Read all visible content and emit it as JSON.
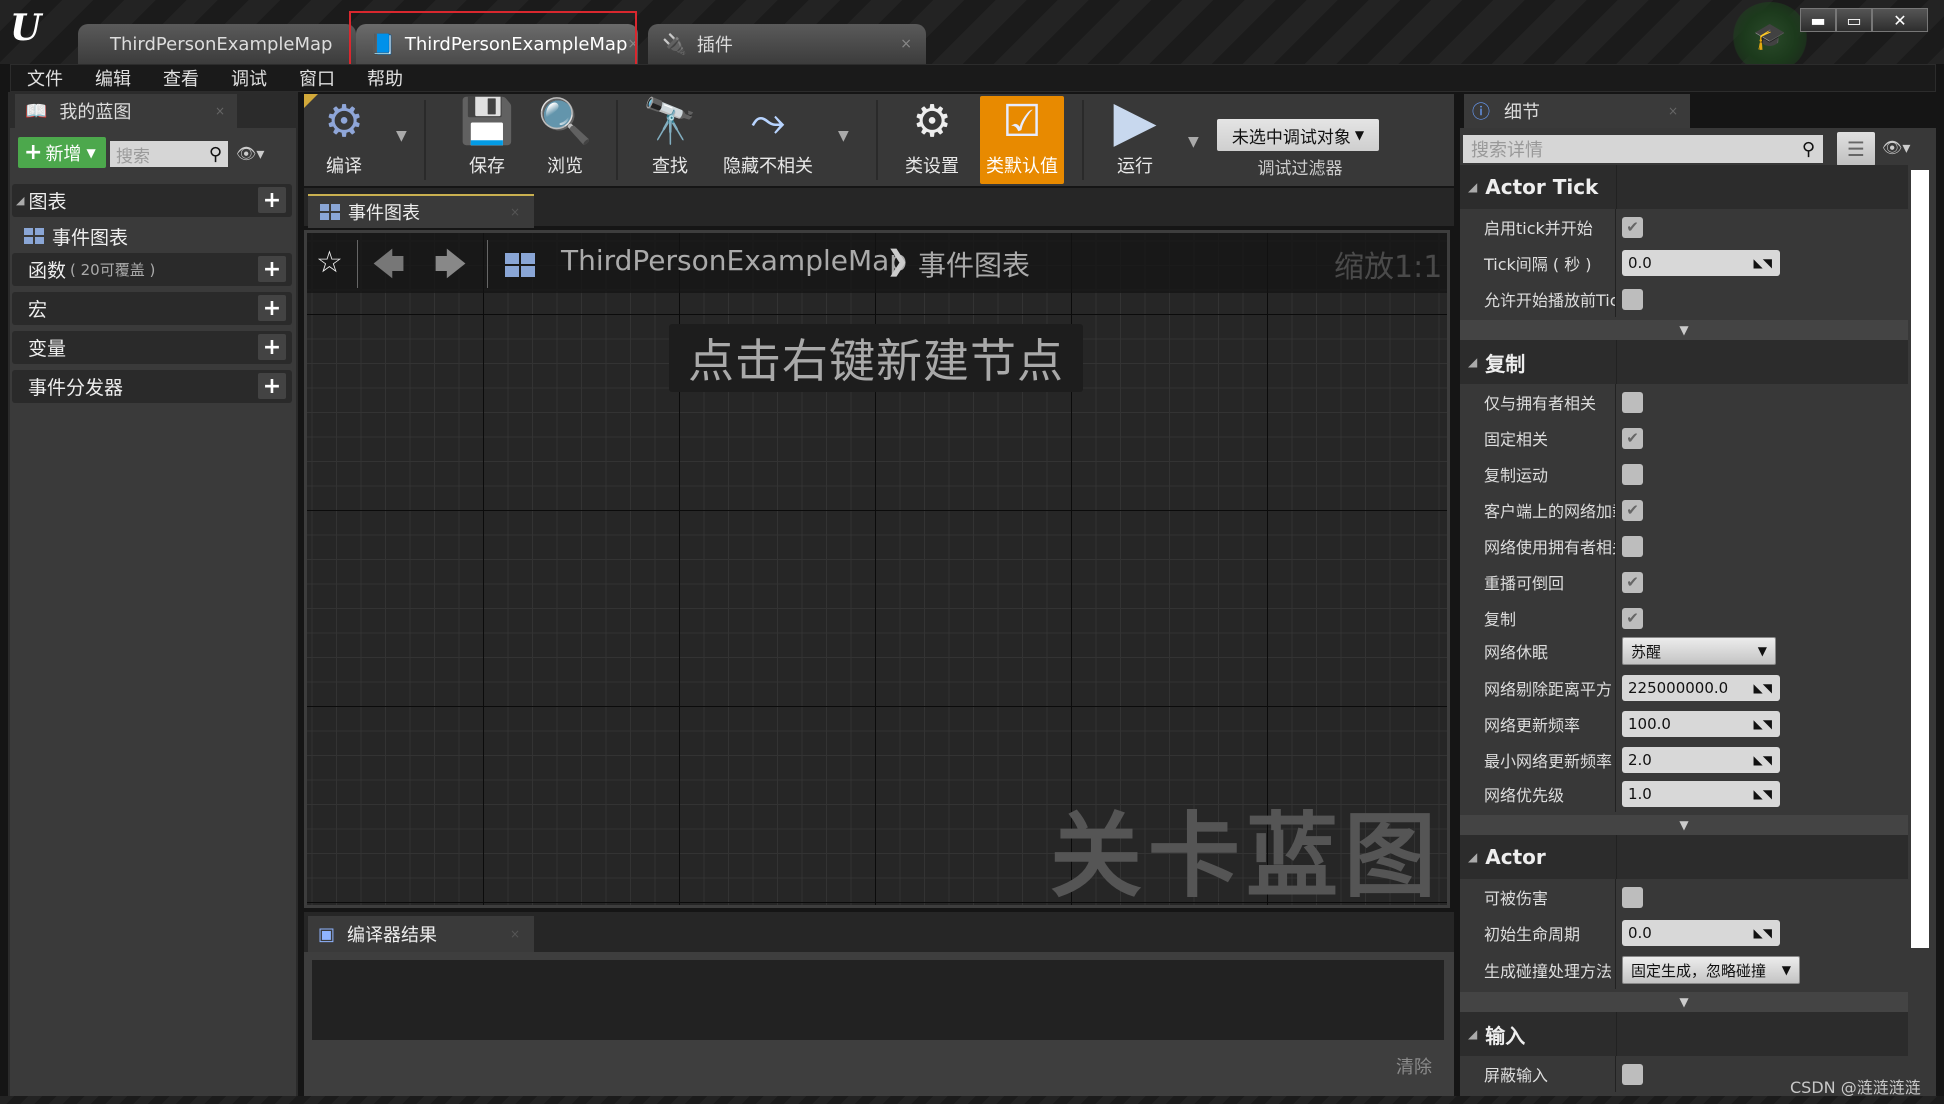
{
  "window": {
    "tabs": [
      {
        "label": "ThirdPersonExampleMap",
        "active": false
      },
      {
        "label": "ThirdPersonExampleMap",
        "active": true
      },
      {
        "label": "插件",
        "active": false
      }
    ],
    "controls": {
      "minimize": "▬",
      "maximize": "▭",
      "close": "✕"
    }
  },
  "menu": [
    "文件",
    "编辑",
    "查看",
    "调试",
    "窗口",
    "帮助"
  ],
  "my_blueprint": {
    "tab_label": "我的蓝图",
    "new_button": "新增",
    "search_placeholder": "搜索",
    "categories": [
      {
        "label": "图表"
      },
      {
        "label": "函数",
        "sub": "( 20可覆盖 )"
      },
      {
        "label": "宏"
      },
      {
        "label": "变量"
      },
      {
        "label": "事件分发器"
      }
    ],
    "graph_item": "事件图表"
  },
  "toolbar": {
    "buttons": [
      {
        "label": "编译",
        "icon": "compile-icon"
      },
      {
        "label": "保存",
        "icon": "save-icon"
      },
      {
        "label": "浏览",
        "icon": "browse-icon"
      },
      {
        "label": "查找",
        "icon": "find-icon"
      },
      {
        "label": "隐藏不相关",
        "icon": "hide-unrelated-icon"
      },
      {
        "label": "类设置",
        "icon": "class-settings-icon"
      },
      {
        "label": "类默认值",
        "icon": "class-defaults-icon",
        "active": true
      },
      {
        "label": "运行",
        "icon": "play-icon"
      }
    ],
    "debug_select": "未选中调试对象",
    "debug_label": "调试过滤器"
  },
  "graph": {
    "tab_label": "事件图表",
    "breadcrumb": [
      "ThirdPersonExampleMap",
      "事件图表"
    ],
    "breadcrumb_sep": "❯",
    "zoom": "缩放1:1",
    "hint": "点击右键新建节点",
    "watermark": "关卡蓝图"
  },
  "compiler": {
    "tab_label": "编译器结果",
    "clear": "清除"
  },
  "details": {
    "tab_label": "细节",
    "search_placeholder": "搜索详情",
    "sections": {
      "actor_tick": {
        "title": "Actor Tick",
        "rows": [
          {
            "label": "启用tick并开始",
            "type": "checkbox",
            "checked": true
          },
          {
            "label": "Tick间隔 ( 秒 )",
            "type": "number",
            "value": "0.0"
          },
          {
            "label": "允许开始播放前Tick",
            "type": "checkbox",
            "checked": false
          }
        ]
      },
      "replication": {
        "title": "复制",
        "rows": [
          {
            "label": "仅与拥有者相关",
            "type": "checkbox",
            "checked": false
          },
          {
            "label": "固定相关",
            "type": "checkbox",
            "checked": true
          },
          {
            "label": "复制运动",
            "type": "checkbox",
            "checked": false
          },
          {
            "label": "客户端上的网络加载",
            "type": "checkbox",
            "checked": true
          },
          {
            "label": "网络使用拥有者相关性",
            "type": "checkbox",
            "checked": false
          },
          {
            "label": "重播可倒回",
            "type": "checkbox",
            "checked": true
          },
          {
            "label": "复制",
            "type": "checkbox",
            "checked": true
          },
          {
            "label": "网络休眠",
            "type": "dropdown",
            "value": "苏醒"
          },
          {
            "label": "网络剔除距离平方",
            "type": "number",
            "value": "225000000.0"
          },
          {
            "label": "网络更新频率",
            "type": "number",
            "value": "100.0"
          },
          {
            "label": "最小网络更新频率",
            "type": "number",
            "value": "2.0"
          },
          {
            "label": "网络优先级",
            "type": "number",
            "value": "1.0"
          }
        ]
      },
      "actor": {
        "title": "Actor",
        "rows": [
          {
            "label": "可被伤害",
            "type": "checkbox",
            "checked": false
          },
          {
            "label": "初始生命周期",
            "type": "number",
            "value": "0.0"
          },
          {
            "label": "生成碰撞处理方法",
            "type": "dropdown",
            "value": "固定生成，忽略碰撞"
          }
        ]
      },
      "input": {
        "title": "输入",
        "rows": [
          {
            "label": "屏蔽输入",
            "type": "checkbox",
            "checked": false
          }
        ]
      }
    }
  },
  "watermark_credit": "CSDN @涟涟涟涟"
}
